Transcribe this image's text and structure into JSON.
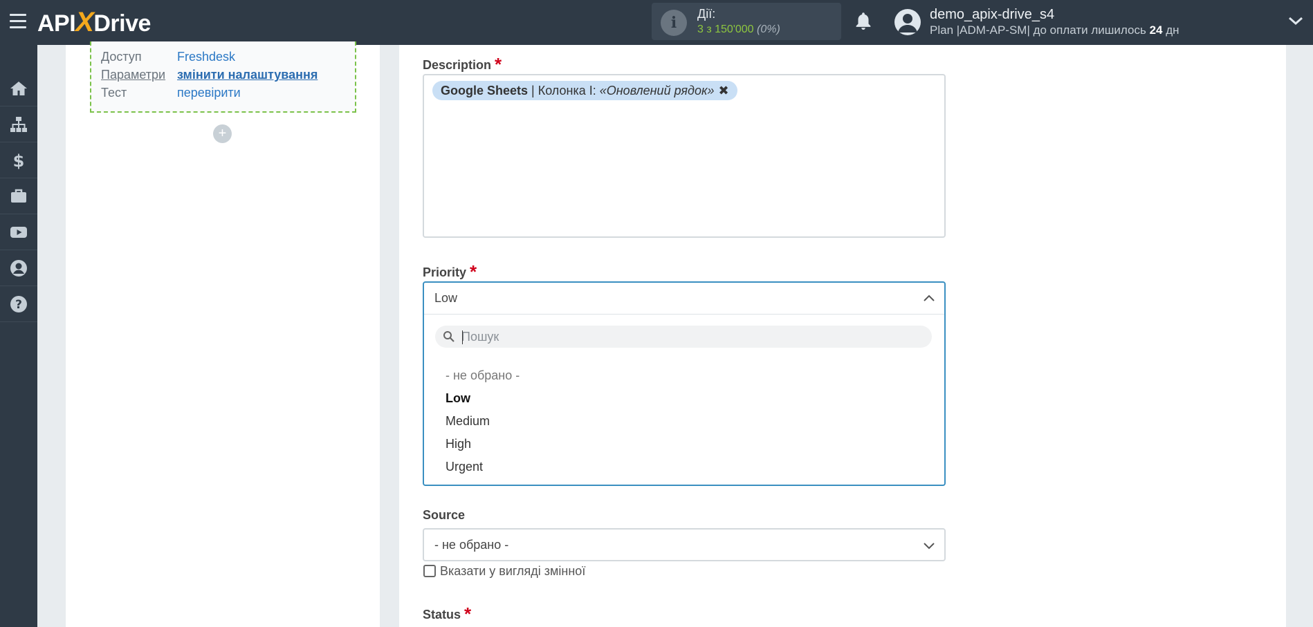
{
  "header": {
    "logo_api": "API",
    "logo_x": "X",
    "logo_drive": "Drive",
    "actions_label": "Дії:",
    "actions_value": "3 з 150'000",
    "actions_pct": "(0%)",
    "user_name": "demo_apix-drive_s4",
    "plan_text": "Plan |ADM-AP-SM| до оплати лишилось",
    "plan_days": "24",
    "plan_days_unit": "дн"
  },
  "sidebar": {
    "items": [
      {
        "icon": "home-icon"
      },
      {
        "icon": "sitemap-icon"
      },
      {
        "icon": "dollar-icon"
      },
      {
        "icon": "briefcase-icon"
      },
      {
        "icon": "youtube-icon"
      },
      {
        "icon": "user-icon"
      },
      {
        "icon": "help-icon"
      }
    ]
  },
  "left": {
    "rows": [
      {
        "key": "Доступ",
        "value": "Freshdesk"
      },
      {
        "key": "Параметри",
        "value": "змінити налаштування"
      },
      {
        "key": "Тест",
        "value": "перевірити"
      }
    ],
    "plus": "+"
  },
  "form": {
    "description_label": "Description",
    "description_tag": {
      "source": "Google Sheets",
      "sep": " | Колонка I: ",
      "value": "«Оновлений рядок»",
      "remove": "✖"
    },
    "priority_label": "Priority",
    "priority_value": "Low",
    "search_placeholder": "Пошук",
    "options": [
      "- не обрано -",
      "Low",
      "Medium",
      "High",
      "Urgent"
    ],
    "source_label": "Source",
    "source_value": "- не обрано -",
    "variable_checkbox_label": "Вказати у вигляді змінної",
    "status_label": "Status",
    "required_mark": "*"
  },
  "colors": {
    "topbar": "#2f3a46",
    "accent_orange": "#f4a81c",
    "link_blue": "#2b78c5",
    "focus_blue": "#3a8fc1",
    "required_red": "#d0021b",
    "actions_green": "#8ec63f"
  }
}
